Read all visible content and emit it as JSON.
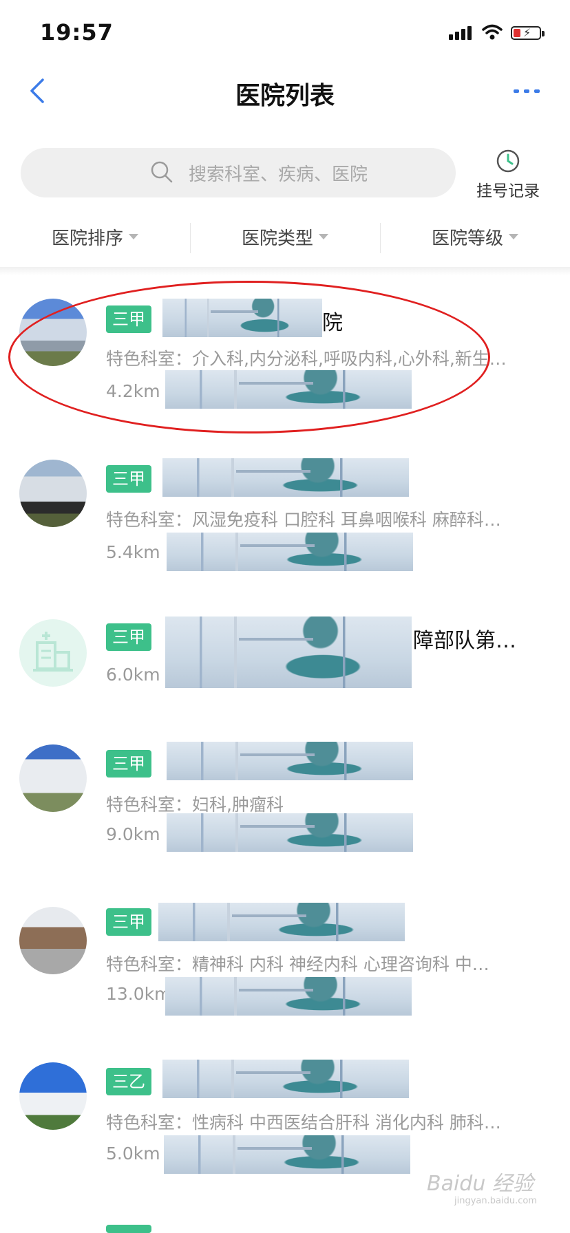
{
  "status_bar": {
    "time": "19:57"
  },
  "nav": {
    "title": "医院列表"
  },
  "search": {
    "placeholder": "搜索科室、疾病、医院"
  },
  "record": {
    "label": "挂号记录"
  },
  "filters": [
    {
      "label": "医院排序"
    },
    {
      "label": "医院类型"
    },
    {
      "label": "医院等级"
    }
  ],
  "hospitals": [
    {
      "tag": "三甲",
      "name_visible": "院",
      "departments": "特色科室：介入科,内分泌科,呼吸内科,心外科,新生…",
      "distance": "4.2km"
    },
    {
      "tag": "三甲",
      "name_visible": "",
      "departments": "特色科室：风湿免疫科 口腔科 耳鼻咽喉科 麻醉科…",
      "distance": "5.4km"
    },
    {
      "tag": "三甲",
      "name_visible": "障部队第…",
      "departments": "",
      "distance": "6.0km"
    },
    {
      "tag": "三甲",
      "name_visible": "",
      "departments": "特色科室：妇科,肿瘤科",
      "distance": "9.0km"
    },
    {
      "tag": "三甲",
      "name_visible": "",
      "departments": "特色科室：精神科 内科 神经内科 心理咨询科 中…",
      "distance": "13.0km"
    },
    {
      "tag": "三乙",
      "name_visible": "",
      "departments": "特色科室：性病科 中西医结合肝科 消化内科 肺科…",
      "distance": "5.0km"
    }
  ],
  "watermark": {
    "text": "Baidu 经验",
    "sub": "jingyan.baidu.com"
  },
  "colors": {
    "accent": "#3b7be8",
    "tag_green": "#3dc08a",
    "annotation_red": "#e02020"
  }
}
